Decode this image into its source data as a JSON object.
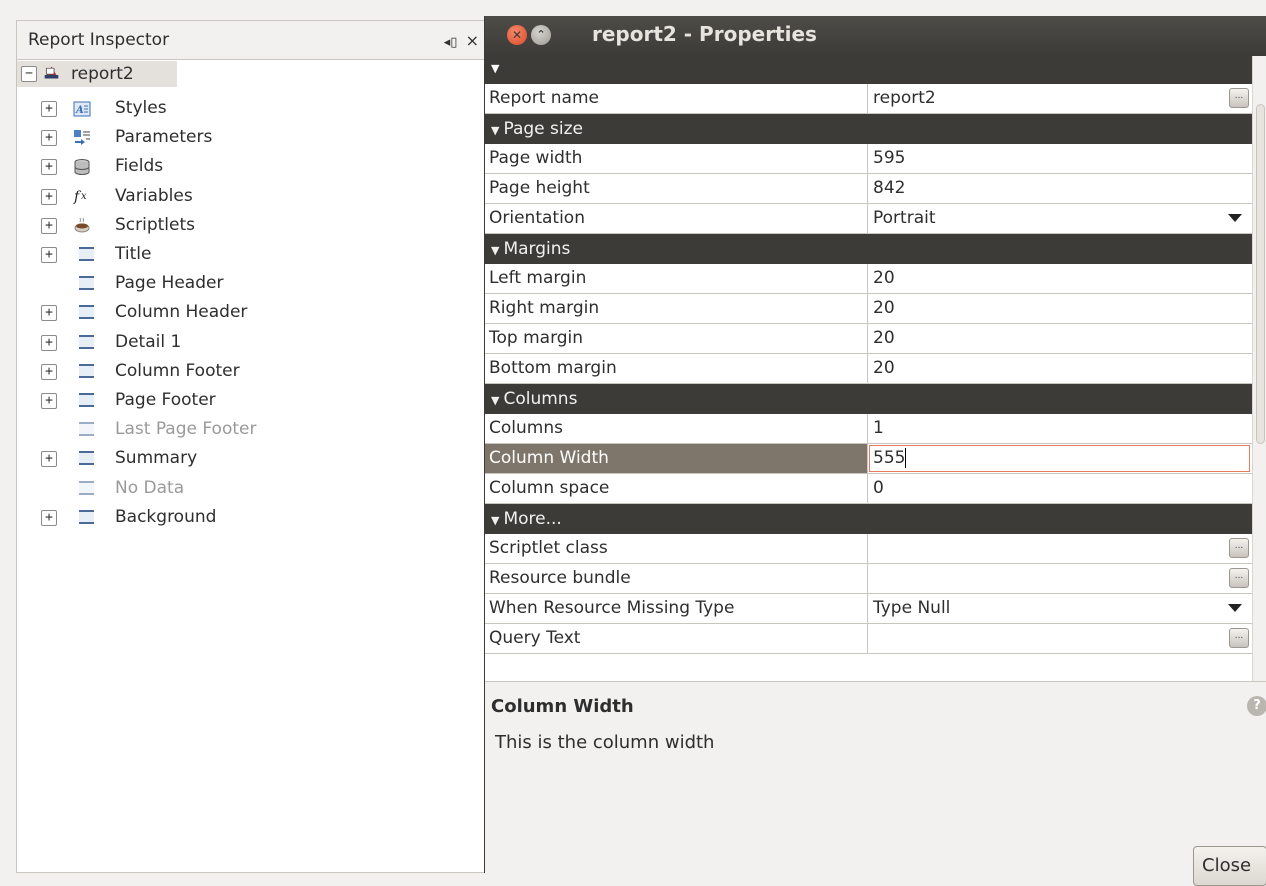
{
  "inspector": {
    "title": "Report Inspector",
    "pin_glyph": "◂▯",
    "close_glyph": "×",
    "root": {
      "expander": "−",
      "label": "report2"
    },
    "items": [
      {
        "label": "Styles",
        "expander": "+",
        "icon": "styles-icon",
        "disabled": false
      },
      {
        "label": "Parameters",
        "expander": "+",
        "icon": "parameters-icon",
        "disabled": false
      },
      {
        "label": "Fields",
        "expander": "+",
        "icon": "fields-icon",
        "disabled": false
      },
      {
        "label": "Variables",
        "expander": "+",
        "icon": "variables-icon",
        "disabled": false
      },
      {
        "label": "Scriptlets",
        "expander": "+",
        "icon": "scriptlets-icon",
        "disabled": false
      },
      {
        "label": "Title",
        "expander": "+",
        "icon": "band-icon",
        "disabled": false
      },
      {
        "label": "Page Header",
        "expander": "",
        "icon": "band-icon",
        "disabled": false
      },
      {
        "label": "Column Header",
        "expander": "+",
        "icon": "band-icon",
        "disabled": false
      },
      {
        "label": "Detail 1",
        "expander": "+",
        "icon": "band-icon",
        "disabled": false
      },
      {
        "label": "Column Footer",
        "expander": "+",
        "icon": "band-icon",
        "disabled": false
      },
      {
        "label": "Page Footer",
        "expander": "+",
        "icon": "band-icon",
        "disabled": false
      },
      {
        "label": "Last Page Footer",
        "expander": "",
        "icon": "band-icon",
        "disabled": true
      },
      {
        "label": "Summary",
        "expander": "+",
        "icon": "band-icon",
        "disabled": false
      },
      {
        "label": "No Data",
        "expander": "",
        "icon": "band-icon",
        "disabled": true
      },
      {
        "label": "Background",
        "expander": "+",
        "icon": "band-icon",
        "disabled": false
      }
    ]
  },
  "properties": {
    "window_title": "report2 - Properties",
    "close_glyph": "✕",
    "minimize_glyph": "⌃",
    "rows": {
      "report_name": {
        "label": "Report name",
        "value": "report2"
      },
      "page_size_section": "Page size",
      "page_width": {
        "label": "Page width",
        "value": "595"
      },
      "page_height": {
        "label": "Page height",
        "value": "842"
      },
      "orientation": {
        "label": "Orientation",
        "value": "Portrait"
      },
      "margins_section": "Margins",
      "left_margin": {
        "label": "Left margin",
        "value": "20"
      },
      "right_margin": {
        "label": "Right margin",
        "value": "20"
      },
      "top_margin": {
        "label": "Top margin",
        "value": "20"
      },
      "bottom_margin": {
        "label": "Bottom margin",
        "value": "20"
      },
      "columns_section": "Columns",
      "columns": {
        "label": "Columns",
        "value": "1"
      },
      "column_width": {
        "label": "Column Width",
        "value": "555"
      },
      "column_space": {
        "label": "Column space",
        "value": "0"
      },
      "more_section": "More...",
      "scriptlet_class": {
        "label": "Scriptlet class",
        "value": ""
      },
      "resource_bundle": {
        "label": "Resource bundle",
        "value": ""
      },
      "when_resource_missing": {
        "label": "When Resource Missing Type",
        "value": "Type Null"
      },
      "query_text": {
        "label": "Query Text",
        "value": ""
      }
    },
    "ellipsis_glyph": "...",
    "description": {
      "title": "Column Width",
      "text": "This is the column width",
      "help_glyph": "?"
    },
    "close_button": "Close"
  }
}
